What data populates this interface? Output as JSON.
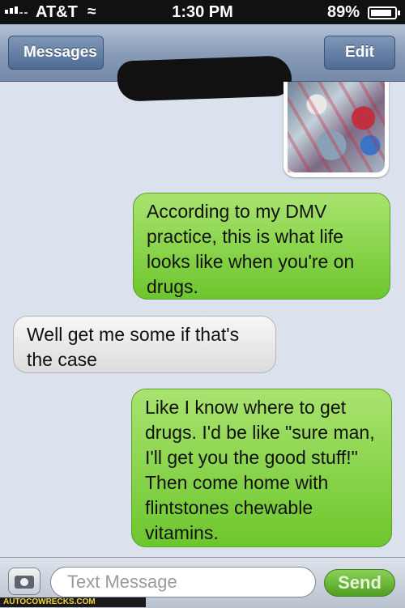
{
  "status_bar": {
    "carrier": "AT&T",
    "wifi_icon": "wifi-icon",
    "time": "1:30 PM",
    "battery_percent": "89%",
    "battery_level": 0.89
  },
  "nav": {
    "back_label": "Messages",
    "edit_label": "Edit"
  },
  "messages": [
    {
      "direction": "out",
      "type": "image"
    },
    {
      "direction": "out",
      "text": "According to my DMV practice, this is what life looks like when you're on drugs."
    },
    {
      "direction": "in",
      "text": "Well get me some if that's the case"
    },
    {
      "direction": "out",
      "text": "Like I know where to get drugs. I'd be like \"sure man, I'll get you the good stuff!\" Then come home with flintstones chewable vitamins."
    }
  ],
  "composer": {
    "placeholder": "Text Message",
    "send_label": "Send",
    "camera_icon": "camera-icon"
  },
  "watermark": "AUTOCOWRECKS.COM",
  "colors": {
    "outgoing_bubble": "#7ccf3d",
    "incoming_bubble": "#e8e8e8",
    "nav_bar": "#8a9db8",
    "background": "#dbe2ed"
  }
}
